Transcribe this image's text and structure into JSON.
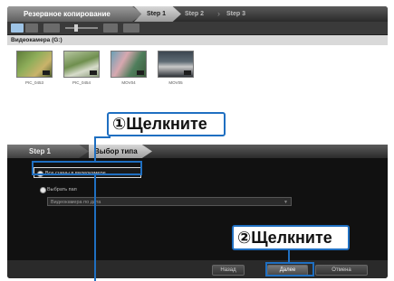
{
  "steps": {
    "title": "Резервное копирование",
    "step1": "Step 1",
    "step2": "Step 2",
    "step3": "Step 3"
  },
  "device": {
    "label": "Видеокамера (G:)"
  },
  "thumbnails": [
    {
      "caption": "PIC_0453"
    },
    {
      "caption": "PIC_0454"
    },
    {
      "caption": "MOV04"
    },
    {
      "caption": "MOV05"
    }
  ],
  "lower": {
    "step_label": "Step 1",
    "section_title": "Выбор типа"
  },
  "options": {
    "all_in_camera": "Все сцены в видеокамере",
    "choose_folder": "Выбрать пап",
    "folder_value": "Видеокамера по дата"
  },
  "footer": {
    "back": "Назад",
    "next": "Далее",
    "cancel": "Отмена"
  },
  "callouts": {
    "c1_num": "①",
    "c1_text": "Щелкните",
    "c2_num": "②",
    "c2_text": "Щелкните"
  },
  "colors": {
    "accent": "#1f6fc1",
    "dark_bg": "#1b1b1b"
  }
}
